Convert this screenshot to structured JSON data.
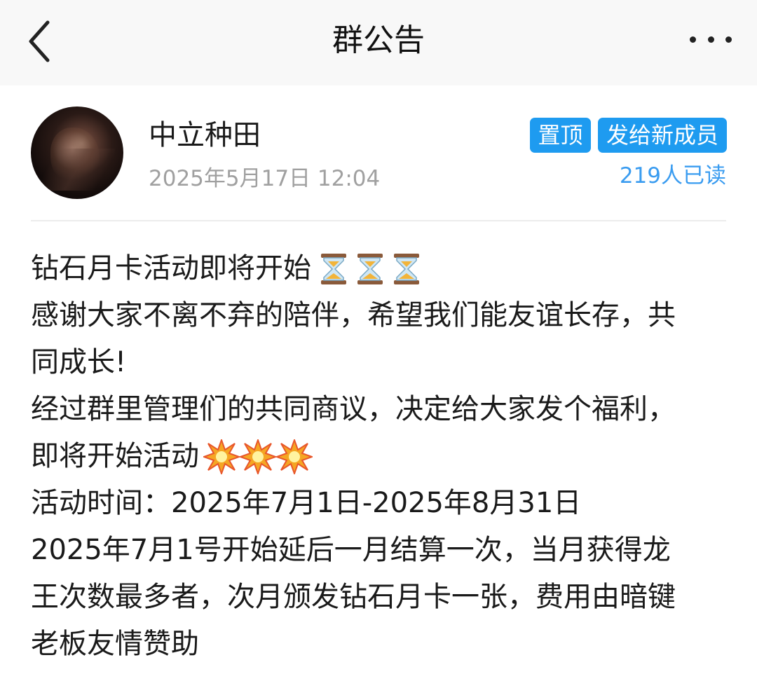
{
  "header": {
    "title": "群公告",
    "back_icon": "chevron-left-icon",
    "more_icon": "more-dots-icon"
  },
  "announcement": {
    "author": "中立种田",
    "time": "2025年5月17日 12:04",
    "tags": {
      "pin": "置顶",
      "send_new_members": "发给新成员"
    },
    "read_count": "219人已读",
    "accent_color": "#1e9bf0",
    "lines": [
      "钻石月卡活动即将开始",
      "感谢大家不离不弃的陪伴，希望我们能友谊长存，共",
      "同成长!",
      "经过群里管理们的共同商议，决定给大家发个福利，",
      "即将开始活动",
      "活动时间：2025年7月1日-2025年8月31日",
      "2025年7月1号开始延后一月结算一次，当月获得龙",
      "王次数最多者，次月颁发钻石月卡一张，费用由暗键",
      "老板友情赞助"
    ],
    "emoji": {
      "line_1": "hourglass-icon ×3",
      "line_5": "collision-icon ×3"
    }
  }
}
